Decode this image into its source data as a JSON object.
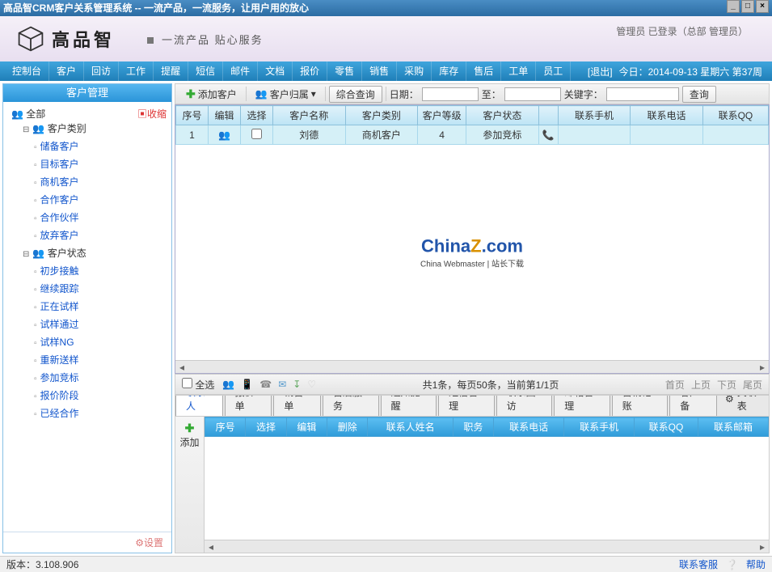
{
  "window": {
    "title": "高品智CRM客户关系管理系统 -- 一流产品，一流服务，让用户用的放心"
  },
  "header": {
    "brand": "高品智",
    "slogan": "一流产品 贴心服务",
    "status": "管理员  已登录（总部 管理员）"
  },
  "menu": {
    "items": [
      "控制台",
      "客户",
      "回访",
      "工作",
      "提醒",
      "短信",
      "邮件",
      "文档",
      "报价",
      "零售",
      "销售",
      "采购",
      "库存",
      "售后",
      "工单",
      "员工"
    ],
    "logout": "[退出]",
    "date": "今日：2014-09-13 星期六 第37周"
  },
  "sidebar": {
    "title": "客户管理",
    "all": "全部",
    "shrink": "收缩",
    "groups": [
      {
        "label": "客户类别",
        "children": [
          "储备客户",
          "目标客户",
          "商机客户",
          "合作客户",
          "合作伙伴",
          "放弃客户"
        ]
      },
      {
        "label": "客户状态",
        "children": [
          "初步接触",
          "继续跟踪",
          "正在试样",
          "试样通过",
          "试样NG",
          "重新送样",
          "参加竞标",
          "报价阶段",
          "已经合作"
        ]
      }
    ],
    "settings": "设置"
  },
  "toolbar": {
    "add": "添加客户",
    "belong": "客户归属",
    "query": "综合查询",
    "date_label": "日期：",
    "to": "至：",
    "keyword": "关键字：",
    "search": "查询"
  },
  "grid": {
    "headers": [
      "序号",
      "编辑",
      "选择",
      "客户名称",
      "客户类别",
      "客户等级",
      "客户状态",
      "",
      "联系手机",
      "联系电话",
      "联系QQ"
    ],
    "rows": [
      {
        "seq": "1",
        "name": "刘德",
        "type": "商机客户",
        "level": "4",
        "status": "参加竞标"
      }
    ]
  },
  "watermark": {
    "sub": "China Webmaster | 站长下载"
  },
  "midbar": {
    "selectall": "全选",
    "stats": "共1条，每页50条，当前第1/1页",
    "pager": [
      "首页",
      "上页",
      "下页",
      "尾页"
    ]
  },
  "tabs": {
    "items": [
      "联系人",
      "报价单",
      "销售单",
      "售后服务",
      "通知提醒",
      "短信管理",
      "联系回访",
      "邮箱管理",
      "营销记账",
      "客户备"
    ],
    "rel": "关联表"
  },
  "subadd": "添加",
  "subgrid": {
    "headers": [
      "序号",
      "选择",
      "编辑",
      "删除",
      "联系人姓名",
      "职务",
      "联系电话",
      "联系手机",
      "联系QQ",
      "联系邮箱"
    ]
  },
  "footer": {
    "version": "版本：3.108.906",
    "contact": "联系客服",
    "help": "帮助"
  }
}
